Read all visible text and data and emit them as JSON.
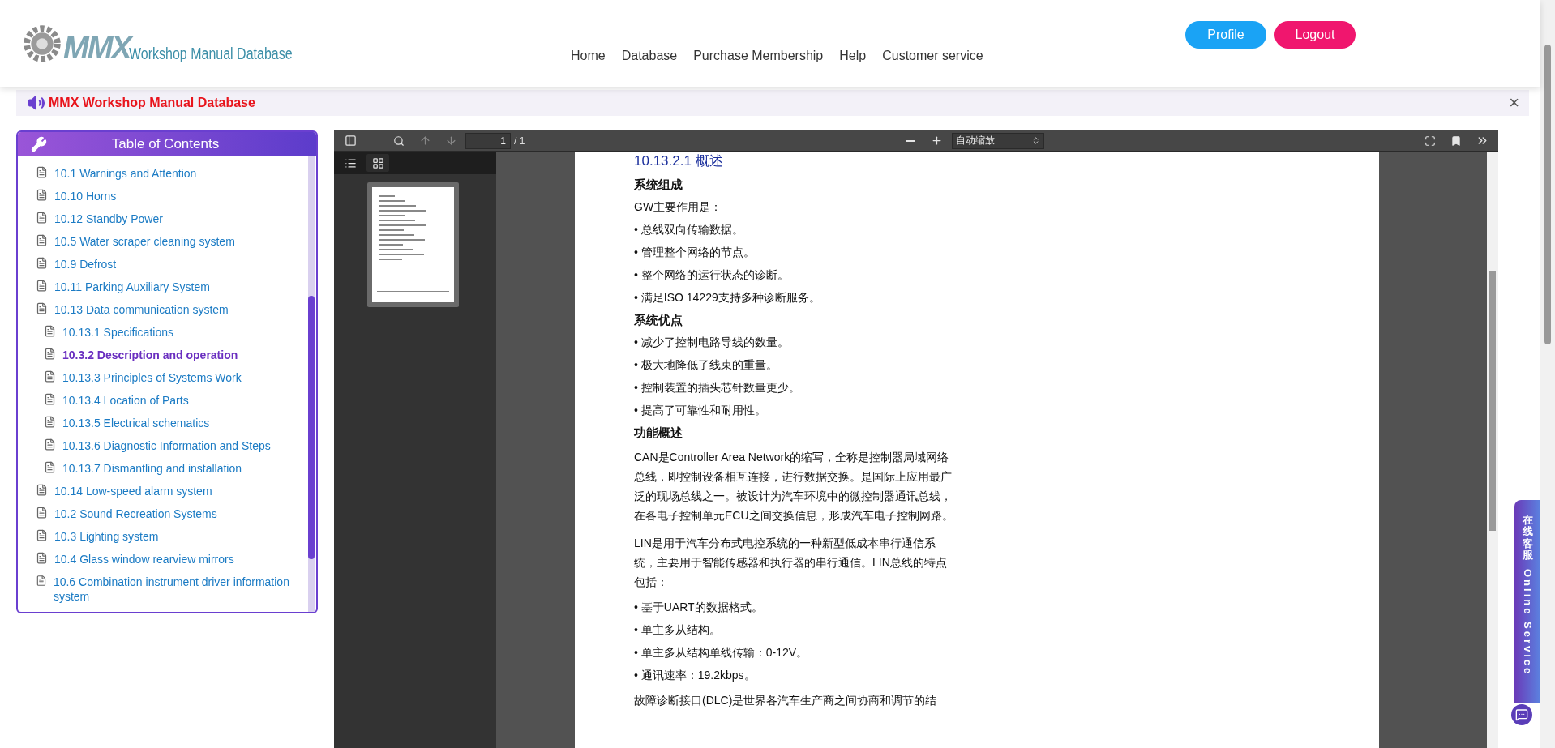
{
  "header": {
    "logo": {
      "mark": "MMX",
      "text": "Workshop Manual Database"
    },
    "nav": [
      "Home",
      "Database",
      "Purchase Membership",
      "Help",
      "Customer service"
    ],
    "buttons": [
      {
        "label": "Profile",
        "kind": "profile"
      },
      {
        "label": "Logout",
        "kind": "logout"
      }
    ]
  },
  "banner": {
    "title": "MMX Workshop Manual Database",
    "close": "×"
  },
  "toc": {
    "title": "Table of Contents",
    "items": [
      {
        "label": "10.1 Warnings and Attention",
        "selected": false
      },
      {
        "label": "10.10 Horns",
        "selected": false
      },
      {
        "label": "10.12 Standby Power",
        "selected": false
      },
      {
        "label": "10.5 Water scraper cleaning system",
        "selected": false
      },
      {
        "label": "10.9 Defrost",
        "selected": false
      },
      {
        "label": "10.11 Parking Auxiliary System",
        "selected": false
      },
      {
        "label": "10.13 Data communication system",
        "selected": false,
        "children": [
          {
            "label": "10.13.1 Specifications",
            "selected": false
          },
          {
            "label": "10.3.2 Description and operation",
            "selected": true
          },
          {
            "label": "10.13.3 Principles of Systems Work",
            "selected": false
          },
          {
            "label": "10.13.4 Location of Parts",
            "selected": false
          },
          {
            "label": "10.13.5 Electrical schematics",
            "selected": false
          },
          {
            "label": "10.13.6 Diagnostic Information and Steps",
            "selected": false
          },
          {
            "label": "10.13.7 Dismantling and installation",
            "selected": false
          }
        ]
      },
      {
        "label": "10.14 Low-speed alarm system",
        "selected": false
      },
      {
        "label": "10.2 Sound Recreation Systems",
        "selected": false
      },
      {
        "label": "10.3 Lighting system",
        "selected": false
      },
      {
        "label": "10.4 Glass window rearview mirrors",
        "selected": false
      },
      {
        "label": "10.6 Combination instrument driver information system",
        "selected": false
      }
    ]
  },
  "viewer": {
    "toolbar": {
      "page": "1",
      "page_count": "/ 1",
      "zoom": "自动缩放"
    },
    "sidebar_views": [
      {
        "kind": "outline",
        "selected": false
      },
      {
        "kind": "thumbnails",
        "selected": true
      }
    ],
    "document": [
      {
        "kind": "heading",
        "text": "10.13.2.1 概述"
      },
      {
        "kind": "subheading",
        "text": "系统组成"
      },
      {
        "kind": "text",
        "text": "GW主要作用是："
      },
      {
        "kind": "bullet",
        "text": "• 总线双向传输数据。"
      },
      {
        "kind": "bullet",
        "text": "• 管理整个网络的节点。"
      },
      {
        "kind": "bullet",
        "text": "• 整个网络的运行状态的诊断。"
      },
      {
        "kind": "bullet",
        "text": "• 满足ISO 14229支持多种诊断服务。"
      },
      {
        "kind": "subheading",
        "text": "系统优点"
      },
      {
        "kind": "bullet",
        "text": "• 减少了控制电路导线的数量。"
      },
      {
        "kind": "bullet",
        "text": "• 极大地降低了线束的重量。"
      },
      {
        "kind": "bullet",
        "text": "• 控制装置的插头芯针数量更少。"
      },
      {
        "kind": "bullet",
        "text": "• 提高了可靠性和耐用性。"
      },
      {
        "kind": "subheading",
        "text": "功能概述"
      },
      {
        "kind": "paragraph",
        "text": "CAN是Controller Area Network的缩写，全称是控制器局域网络总线，即控制设备相互连接，进行数据交换。是国际上应用最广泛的现场总线之一。被设计为汽车环境中的微控制器通讯总线，在各电子控制单元ECU之间交换信息，形成汽车电子控制网路。"
      },
      {
        "kind": "paragraph",
        "text": "LIN是用于汽车分布式电控系统的一种新型低成本串行通信系统，主要用于智能传感器和执行器的串行通信。LIN总线的特点包括："
      },
      {
        "kind": "bullet",
        "text": "• 基于UART的数据格式。"
      },
      {
        "kind": "bullet",
        "text": "• 单主多从结构。"
      },
      {
        "kind": "bullet",
        "text": "• 单主多从结构单线传输：0-12V。"
      },
      {
        "kind": "bullet",
        "text": "• 通讯速率：19.2kbps。"
      },
      {
        "kind": "paragraph",
        "text": "故障诊断接口(DLC)是世界各汽车生产商之间协商和调节的结"
      }
    ]
  },
  "service": {
    "chinese": "在线客服",
    "english": "Online Service"
  }
}
